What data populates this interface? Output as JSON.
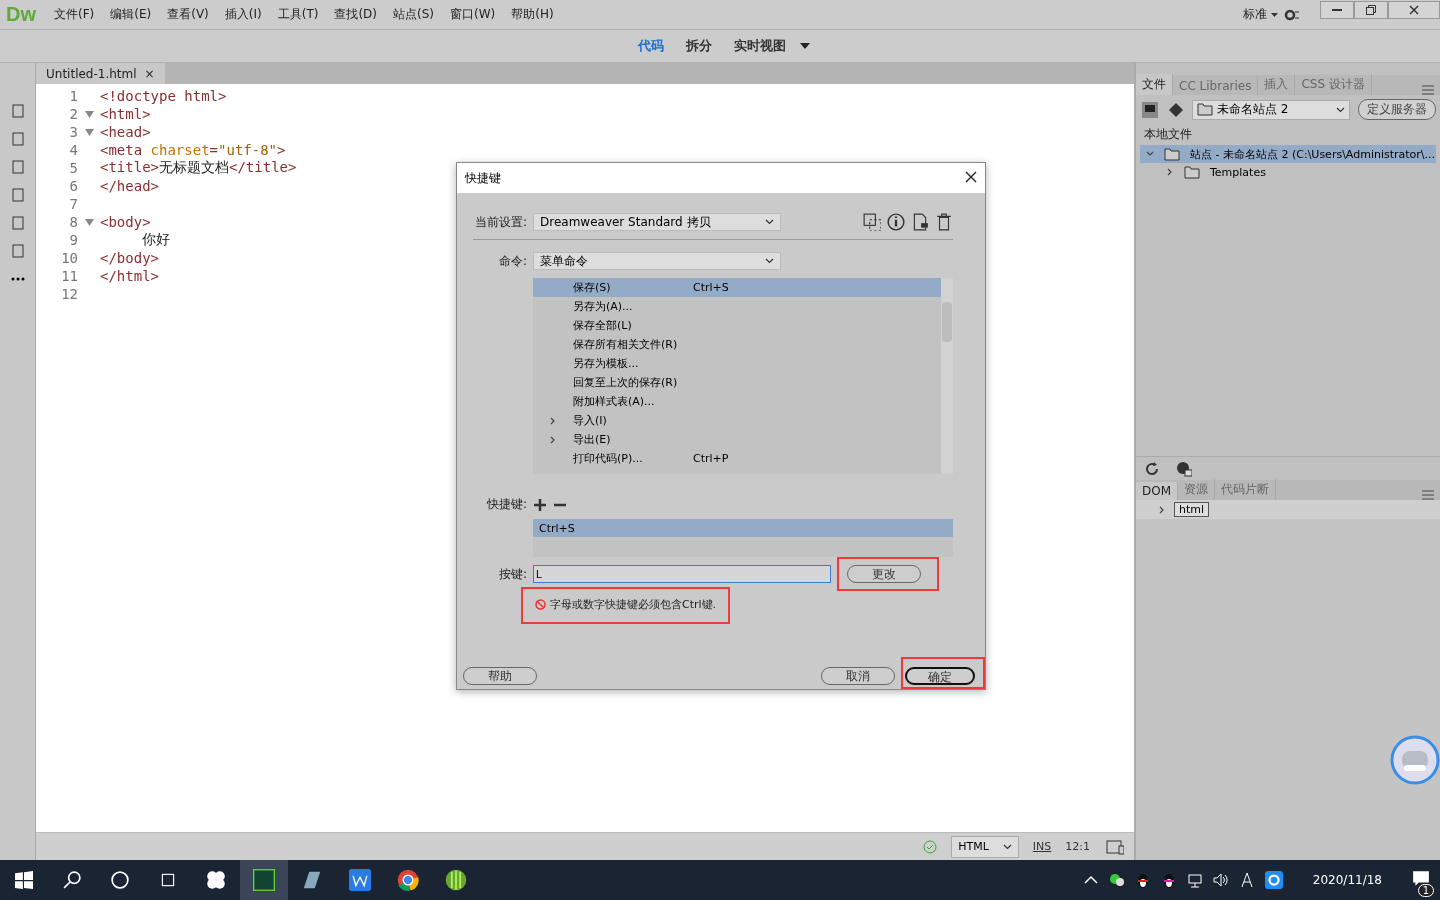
{
  "app": {
    "logo": "Dw"
  },
  "menu": [
    "文件(F)",
    "编辑(E)",
    "查看(V)",
    "插入(I)",
    "工具(T)",
    "查找(D)",
    "站点(S)",
    "窗口(W)",
    "帮助(H)"
  ],
  "workspace": "标准",
  "view_switcher": [
    {
      "label": "代码",
      "selected": true
    },
    {
      "label": "拆分",
      "selected": false
    },
    {
      "label": "实时视图",
      "selected": false
    }
  ],
  "document_tab": {
    "label": "Untitled-1.html",
    "close": "×"
  },
  "code_lines": [
    {
      "number": "1",
      "foldable": false,
      "segments": [
        {
          "kind": "tag",
          "text": "<!doctype html>"
        }
      ]
    },
    {
      "number": "2",
      "foldable": true,
      "segments": [
        {
          "kind": "tag",
          "text": "<html>"
        }
      ]
    },
    {
      "number": "3",
      "foldable": true,
      "segments": [
        {
          "kind": "tag",
          "text": "<head>"
        }
      ]
    },
    {
      "number": "4",
      "foldable": false,
      "segments": [
        {
          "kind": "tag",
          "text": "<meta "
        },
        {
          "kind": "attr",
          "text": "charset"
        },
        {
          "kind": "tag",
          "text": "="
        },
        {
          "kind": "value",
          "text": "\"utf-8\""
        },
        {
          "kind": "tag",
          "text": ">"
        }
      ]
    },
    {
      "number": "5",
      "foldable": false,
      "segments": [
        {
          "kind": "tag",
          "text": "<title>"
        },
        {
          "kind": "text",
          "text": "无标题文档"
        },
        {
          "kind": "tag",
          "text": "</title>"
        }
      ]
    },
    {
      "number": "6",
      "foldable": false,
      "segments": [
        {
          "kind": "tag",
          "text": "</head>"
        }
      ]
    },
    {
      "number": "7",
      "foldable": false
    },
    {
      "number": "8",
      "foldable": true,
      "segments": [
        {
          "kind": "tag",
          "text": "<body>"
        }
      ]
    },
    {
      "number": "9",
      "foldable": false,
      "segments": [
        {
          "kind": "text",
          "text": "     你好"
        }
      ]
    },
    {
      "number": "10",
      "foldable": false,
      "segments": [
        {
          "kind": "tag",
          "text": "</body>"
        }
      ]
    },
    {
      "number": "11",
      "foldable": false,
      "segments": [
        {
          "kind": "tag",
          "text": "</html>"
        }
      ]
    },
    {
      "number": "12",
      "foldable": false
    }
  ],
  "dialog": {
    "title": "快捷键",
    "settings_label": "当前设置:",
    "settings_value": "Dreamweaver Standard 拷贝",
    "command_label": "命令:",
    "command_value": "菜单命令",
    "commands": [
      {
        "label": "保存(S)",
        "shortcut": "Ctrl+S",
        "expandable": false,
        "selected": true
      },
      {
        "label": "另存为(A)...",
        "expandable": false,
        "selected": false
      },
      {
        "label": "保存全部(L)",
        "expandable": false,
        "selected": false
      },
      {
        "label": "保存所有相关文件(R)",
        "expandable": false,
        "selected": false
      },
      {
        "label": "另存为模板...",
        "expandable": false,
        "selected": false
      },
      {
        "label": "回复至上次的保存(R)",
        "expandable": false,
        "selected": false
      },
      {
        "label": "附加样式表(A)...",
        "expandable": false,
        "selected": false
      },
      {
        "label": "导入(I)",
        "expandable": true,
        "selected": false
      },
      {
        "label": "导出(E)",
        "expandable": true,
        "selected": false
      },
      {
        "label": "打印代码(P)...",
        "shortcut": "Ctrl+P",
        "expandable": false,
        "selected": false
      }
    ],
    "shortcut_label": "快捷键:",
    "shortcuts": [
      {
        "label": "Ctrl+S",
        "selected": true
      }
    ],
    "key_label": "按键:",
    "key_value": "L",
    "change_button": "更改",
    "error": "字母或数字快捷键必须包含Ctrl键.",
    "help_button": "帮助",
    "cancel_button": "取消",
    "ok_button": "确定"
  },
  "files_panel": {
    "tabs": [
      {
        "label": "文件",
        "selected": true
      },
      {
        "label": "CC Libraries",
        "selected": false
      },
      {
        "label": "插入",
        "selected": false
      },
      {
        "label": "CSS 设计器",
        "selected": false
      }
    ],
    "site": "未命名站点 2",
    "define_server": "定义服务器",
    "local_files": "本地文件",
    "tree": [
      {
        "label": "站点 - 未命名站点 2 (C:\\Users\\Administrator\\...",
        "expanded": true,
        "selected": true,
        "children": [
          {
            "label": "Templates",
            "expanded": false,
            "selected": false
          }
        ]
      }
    ]
  },
  "dom_panel": {
    "tabs": [
      {
        "label": "DOM",
        "selected": true
      },
      {
        "label": "资源",
        "selected": false
      },
      {
        "label": "代码片断",
        "selected": false
      }
    ],
    "node": "html"
  },
  "status_bar": {
    "language": "HTML",
    "mode": "INS",
    "position": "12:1"
  },
  "taskbar": {
    "date": "2020/11/18",
    "notifications": "1"
  }
}
